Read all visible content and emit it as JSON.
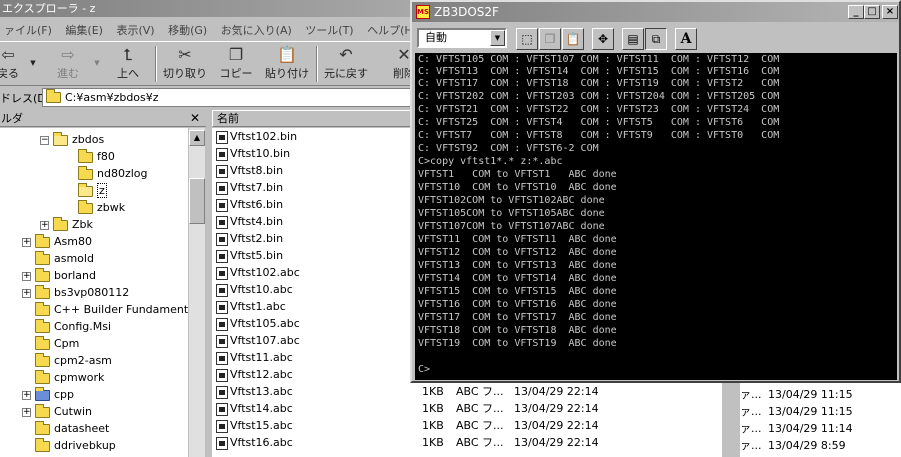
{
  "explorer": {
    "title": "エクスプローラ - z",
    "menu": [
      "ァイル(F)",
      "編集(E)",
      "表示(V)",
      "移動(G)",
      "お気に入り(A)",
      "ツール(T)",
      "ヘルプ(H)"
    ],
    "toolbar": {
      "back": "戻る",
      "forward": "進む",
      "up": "上へ",
      "cut": "切り取り",
      "copy": "コピー",
      "paste": "貼り付け",
      "undo": "元に戻す",
      "delete": "削除"
    },
    "address_label": "ドレス(D)",
    "address_value": "C:¥asm¥zbdos¥z",
    "tree_header": "ルダ",
    "tree": [
      {
        "label": "zbdos",
        "expander": "−"
      },
      {
        "label": "f80",
        "expander": ""
      },
      {
        "label": "nd80zlog",
        "expander": ""
      },
      {
        "label": "z",
        "expander": ""
      },
      {
        "label": "zbwk",
        "expander": ""
      },
      {
        "label": "Zbk",
        "expander": "+"
      },
      {
        "label": "Asm80",
        "expander": "+"
      },
      {
        "label": "asmold",
        "expander": ""
      },
      {
        "label": "borland",
        "expander": "+"
      },
      {
        "label": "bs3vp080112",
        "expander": "+"
      },
      {
        "label": "C++ Builder Fundamental",
        "expander": ""
      },
      {
        "label": "Config.Msi",
        "expander": ""
      },
      {
        "label": "Cpm",
        "expander": ""
      },
      {
        "label": "cpm2-asm",
        "expander": ""
      },
      {
        "label": "cpmwork",
        "expander": ""
      },
      {
        "label": "cpp",
        "expander": "+"
      },
      {
        "label": "Cutwin",
        "expander": "+"
      },
      {
        "label": "datasheet",
        "expander": ""
      },
      {
        "label": "ddrivebkup",
        "expander": ""
      }
    ],
    "list_header_name": "名前",
    "files": [
      {
        "name": "Vftst102.bin",
        "size": "",
        "type": "",
        "date": ""
      },
      {
        "name": "Vftst10.bin",
        "size": "",
        "type": "",
        "date": ""
      },
      {
        "name": "Vftst8.bin",
        "size": "",
        "type": "",
        "date": ""
      },
      {
        "name": "Vftst7.bin",
        "size": "",
        "type": "",
        "date": ""
      },
      {
        "name": "Vftst6.bin",
        "size": "",
        "type": "",
        "date": ""
      },
      {
        "name": "Vftst4.bin",
        "size": "",
        "type": "",
        "date": ""
      },
      {
        "name": "Vftst2.bin",
        "size": "",
        "type": "",
        "date": ""
      },
      {
        "name": "Vftst5.bin",
        "size": "",
        "type": "",
        "date": ""
      },
      {
        "name": "Vftst102.abc",
        "size": "",
        "type": "",
        "date": ""
      },
      {
        "name": "Vftst10.abc",
        "size": "",
        "type": "",
        "date": ""
      },
      {
        "name": "Vftst1.abc",
        "size": "",
        "type": "",
        "date": ""
      },
      {
        "name": "Vftst105.abc",
        "size": "",
        "type": "",
        "date": ""
      },
      {
        "name": "Vftst107.abc",
        "size": "",
        "type": "",
        "date": ""
      },
      {
        "name": "Vftst11.abc",
        "size": "",
        "type": "",
        "date": ""
      },
      {
        "name": "Vftst12.abc",
        "size": "",
        "type": "",
        "date": ""
      },
      {
        "name": "Vftst13.abc",
        "size": "1KB",
        "type": "ABC フ...",
        "date": "13/04/29 22:14"
      },
      {
        "name": "Vftst14.abc",
        "size": "1KB",
        "type": "ABC フ...",
        "date": "13/04/29 22:14"
      },
      {
        "name": "Vftst15.abc",
        "size": "1KB",
        "type": "ABC フ...",
        "date": "13/04/29 22:14"
      },
      {
        "name": "Vftst16.abc",
        "size": "1KB",
        "type": "ABC フ...",
        "date": "13/04/29 22:14"
      }
    ],
    "right_column": [
      {
        "attr": "ァ...",
        "date": "13/04/29 11:15"
      },
      {
        "attr": "ァ...",
        "date": "13/04/29 11:15"
      },
      {
        "attr": "ァ...",
        "date": "13/04/29 11:14"
      },
      {
        "attr": "ァ...",
        "date": "13/04/29 8:59"
      }
    ]
  },
  "console": {
    "title": "ZB3DOS2F",
    "icon_label": "MS",
    "font_select": "自動",
    "buttons": {
      "minimize": "_",
      "maximize": "□",
      "close": "×",
      "font": "A"
    },
    "lines": [
      "C: VFTST105 COM : VFTST107 COM : VFTST11  COM : VFTST12  COM",
      "C: VFTST13  COM : VFTST14  COM : VFTST15  COM : VFTST16  COM",
      "C: VFTST17  COM : VFTST18  COM : VFTST19  COM : VFTST2   COM",
      "C: VFTST202 COM : VFTST203 COM : VFTST204 COM : VFTST205 COM",
      "C: VFTST21  COM : VFTST22  COM : VFTST23  COM : VFTST24  COM",
      "C: VFTST25  COM : VFTST4   COM : VFTST5   COM : VFTST6   COM",
      "C: VFTST7   COM : VFTST8   COM : VFTST9   COM : VFTST0   COM",
      "C: VFTST92  COM : VFTST6-2 COM",
      "C>copy vftst1*.* z:*.abc",
      "VFTST1   COM to VFTST1   ABC done",
      "VFTST10  COM to VFTST10  ABC done",
      "VFTST102COM to VFTST102ABC done",
      "VFTST105COM to VFTST105ABC done",
      "VFTST107COM to VFTST107ABC done",
      "VFTST11  COM to VFTST11  ABC done",
      "VFTST12  COM to VFTST12  ABC done",
      "VFTST13  COM to VFTST13  ABC done",
      "VFTST14  COM to VFTST14  ABC done",
      "VFTST15  COM to VFTST15  ABC done",
      "VFTST16  COM to VFTST16  ABC done",
      "VFTST17  COM to VFTST17  ABC done",
      "VFTST18  COM to VFTST18  ABC done",
      "VFTST19  COM to VFTST19  ABC done",
      "",
      "C>"
    ]
  }
}
